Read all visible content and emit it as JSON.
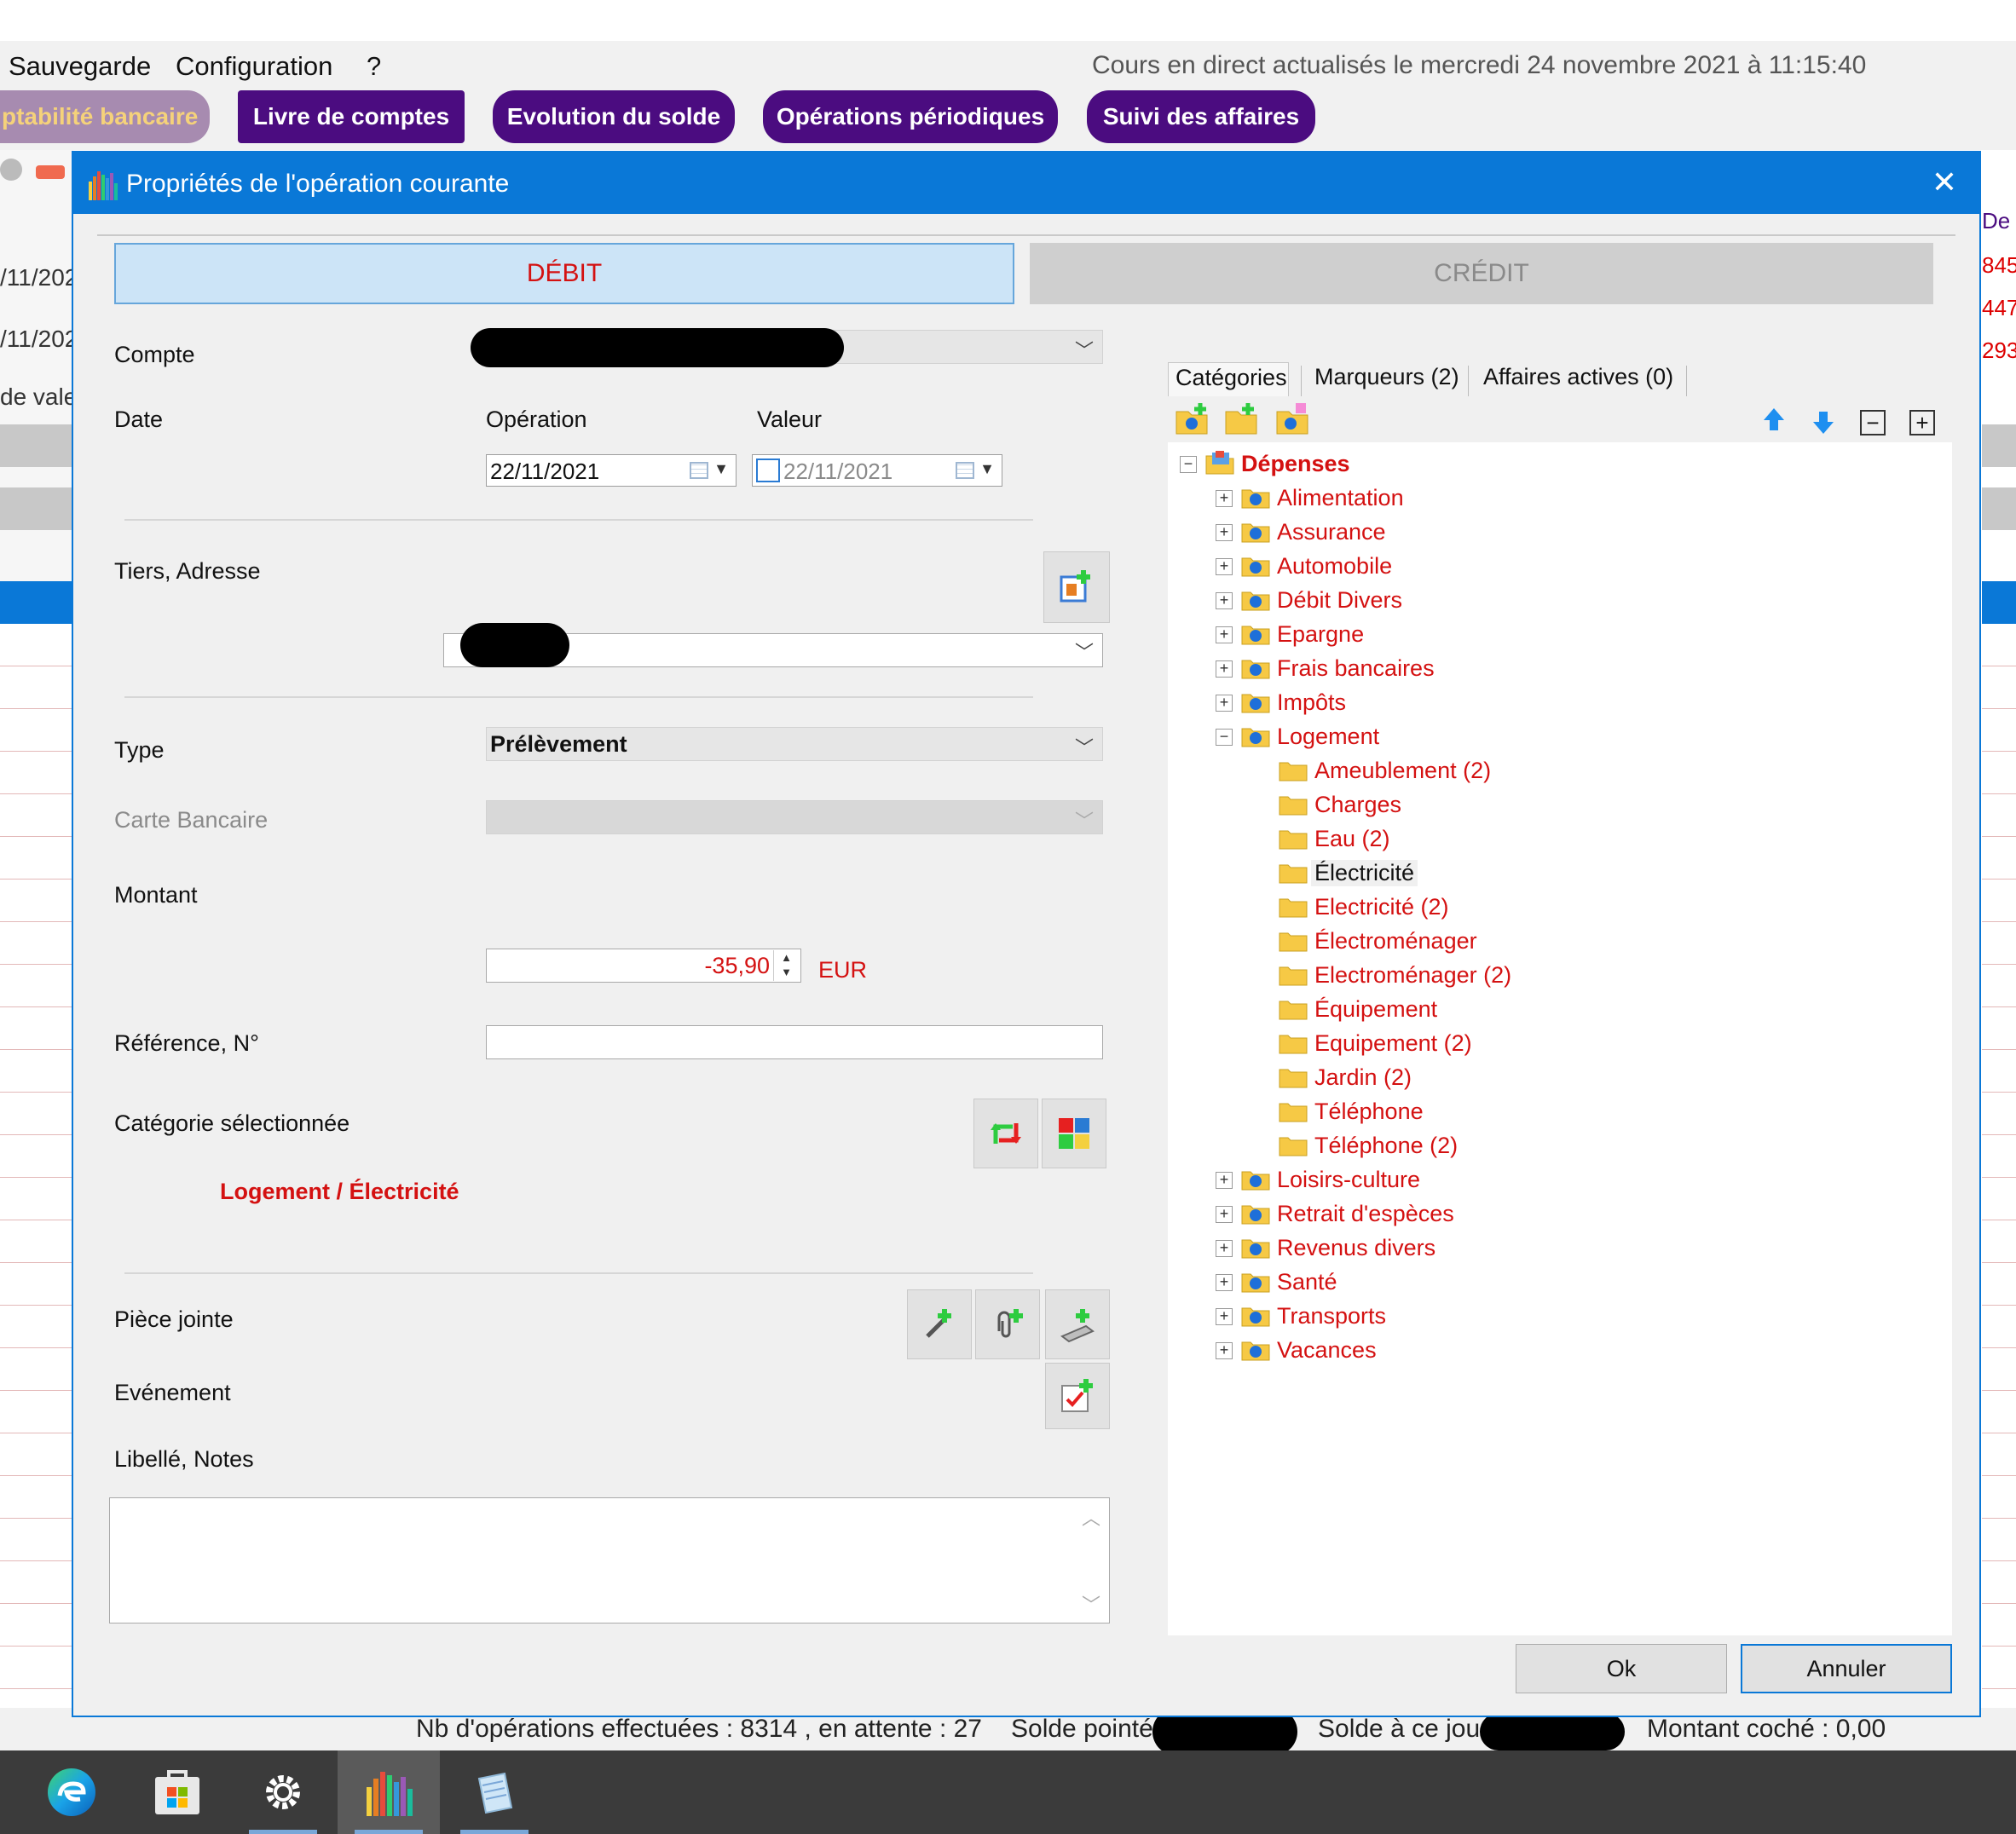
{
  "menubar": {
    "items": [
      "Sauvegarde",
      "Configuration",
      "?"
    ],
    "live_status": "Cours en direct actualisés le mercredi 24 novembre 2021 à 11:15:40"
  },
  "app_tabs": [
    "ptabilité bancaire",
    "Livre de comptes",
    "Evolution du solde",
    "Opérations périodiques",
    "Suivi des affaires"
  ],
  "background": {
    "left_cells": [
      "/11/202",
      "/11/202",
      "de vale"
    ],
    "right_numbers": [
      "De",
      "845",
      "447",
      "293"
    ]
  },
  "statusbar": {
    "ops_done": "Nb d'opérations effectuées : 8314 , en attente : 27",
    "solde_pointe": "Solde pointé",
    "solde_jour": "Solde à ce jour",
    "montant_coche": "Montant coché : 0,00"
  },
  "dialog": {
    "title": "Propriétés de l'opération courante",
    "debit_label": "DÉBIT",
    "credit_label": "CRÉDIT",
    "labels": {
      "compte": "Compte",
      "date": "Date",
      "operation": "Opération",
      "valeur": "Valeur",
      "tiers": "Tiers, Adresse",
      "type": "Type",
      "carte": "Carte Bancaire",
      "montant": "Montant",
      "reference": "Référence, N°",
      "categorie": "Catégorie sélectionnée",
      "piece": "Pièce jointe",
      "evenement": "Evénement",
      "notes": "Libellé, Notes"
    },
    "date_operation": "22/11/2021",
    "date_valeur": "22/11/2021",
    "type_value": "Prélèvement",
    "amount": "-35,90",
    "currency": "EUR",
    "selected_category": "Logement / Électricité",
    "ok_label": "Ok",
    "cancel_label": "Annuler"
  },
  "tree_tabs": [
    "Catégories",
    "Marqueurs (2)",
    "Affaires actives (0)"
  ],
  "tree": {
    "root": "Dépenses",
    "top_items": [
      "Alimentation",
      "Assurance",
      "Automobile",
      "Débit Divers",
      "Epargne",
      "Frais bancaires",
      "Impôts",
      "Logement"
    ],
    "logement_children": [
      "Ameublement (2)",
      "Charges",
      "Eau (2)",
      "Électricité",
      "Electricité (2)",
      "Électroménager",
      "Electroménager (2)",
      "Équipement",
      "Equipement (2)",
      "Jardin (2)",
      "Téléphone",
      "Téléphone (2)"
    ],
    "bottom_items": [
      "Loisirs-culture",
      "Retrait d'espèces",
      "Revenus divers",
      "Santé",
      "Transports",
      "Vacances"
    ],
    "selected": "Électricité"
  },
  "colors": {
    "accent_blue": "#0a78d7",
    "app_tab_purple": "#4b0c80",
    "category_red": "#d41111"
  },
  "icons": [
    "edge-icon",
    "store-icon",
    "settings-icon",
    "app-bars-icon",
    "notepad-icon",
    "folder-icon",
    "star-folder-icon",
    "arrow-up-icon",
    "arrow-down-icon",
    "collapse-icon",
    "expand-icon"
  ]
}
